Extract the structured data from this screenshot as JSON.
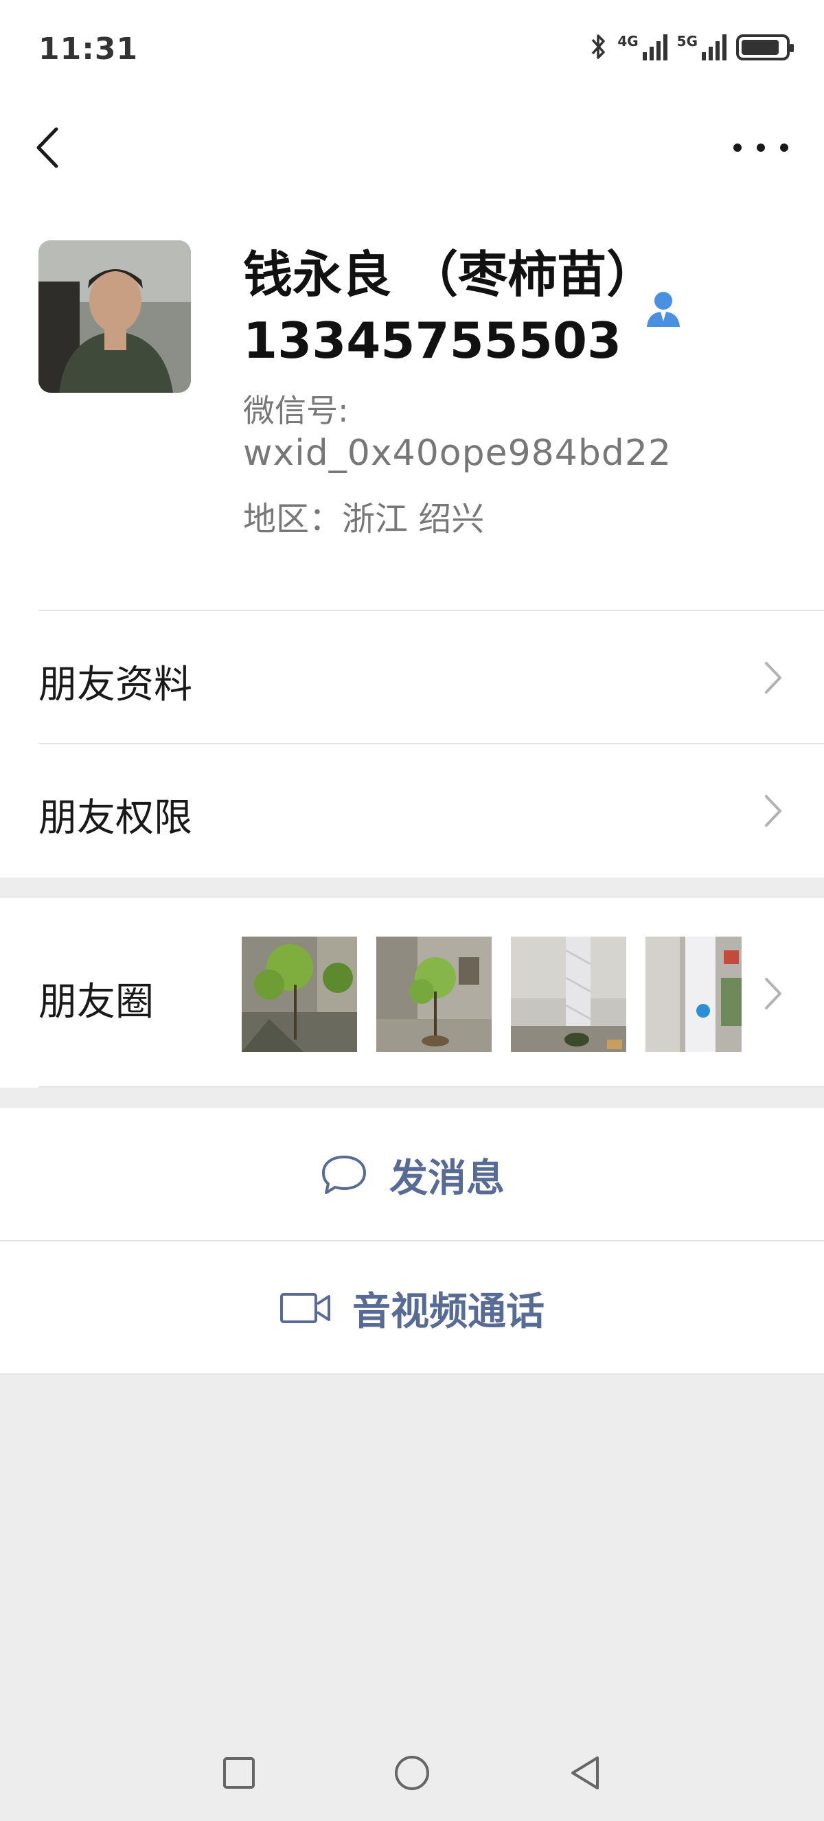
{
  "status_bar": {
    "time": "11:31",
    "signal_1": "4G",
    "signal_2": "5G"
  },
  "nav": {
    "back_icon": "chevron-left-icon",
    "more_icon": "more-dots-icon"
  },
  "profile": {
    "name_line_1": "钱永良 （枣柿苗）",
    "name_line_2": "13345755503",
    "wxid_label": "微信号:",
    "wxid_value": "wxid_0x40ope984bd22",
    "region": "地区：浙江  绍兴"
  },
  "menu": {
    "friend_info": "朋友资料",
    "friend_permissions": "朋友权限",
    "moments": "朋友圈"
  },
  "actions": {
    "send_message": "发消息",
    "video_call": "音视频通话"
  },
  "colors": {
    "link_blue": "#576b95",
    "background": "#ededed",
    "contact_icon_blue": "#4a90e2"
  }
}
